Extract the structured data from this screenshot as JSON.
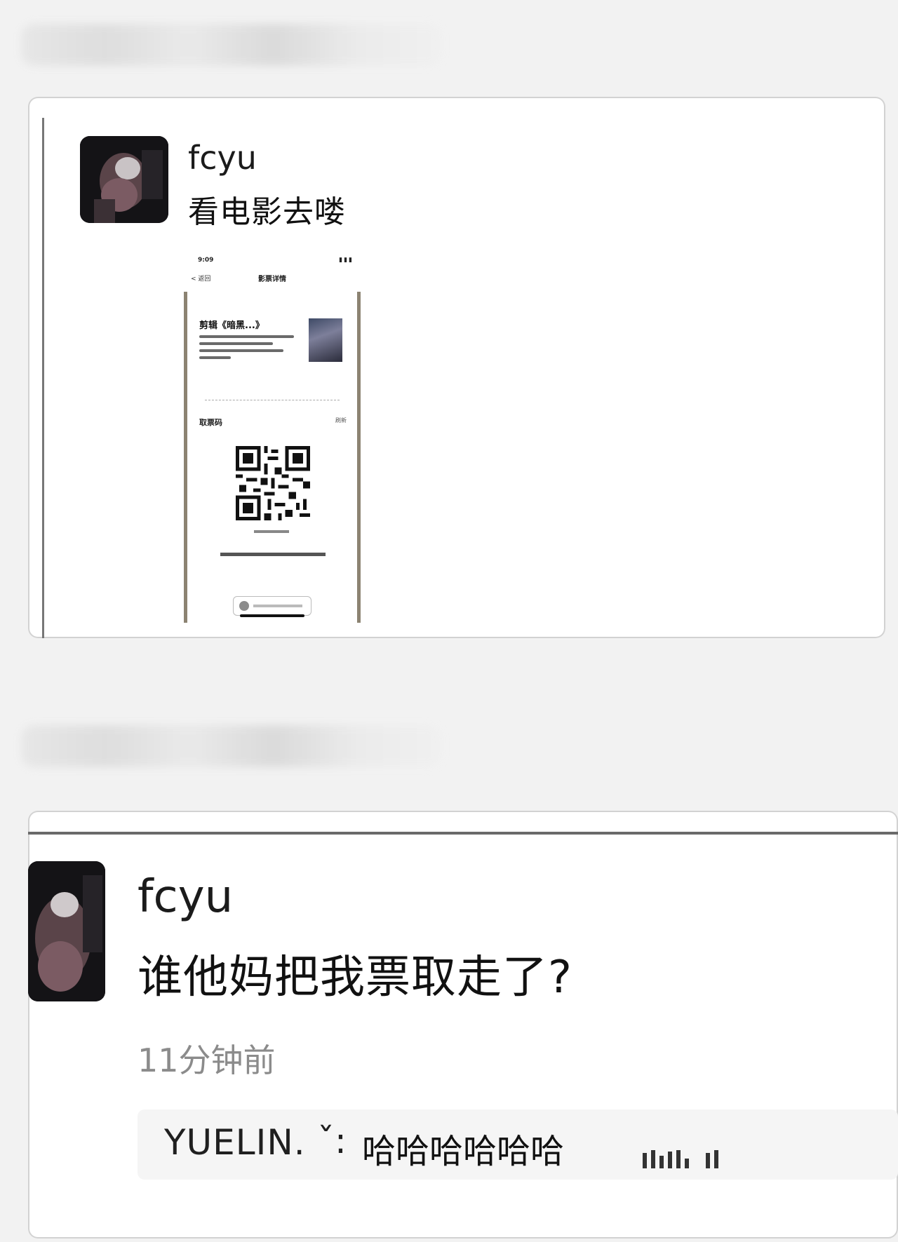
{
  "post1": {
    "username": "fcyu",
    "text": "看电影去喽",
    "ticket_screenshot": {
      "status_time": "9:09",
      "status_icons": "▮▮▮",
      "back_label": "< 返回",
      "title": "影票详情",
      "movie_title": "剪辑《暗黑...》",
      "code_label": "取票码",
      "code_right": "刷新"
    }
  },
  "post2": {
    "username": "fcyu",
    "text": "谁他妈把我票取走了?",
    "timestamp": "11分钟前",
    "comment": {
      "name": "YUELIN.",
      "separator": "ˇ:",
      "text": "哈哈哈哈哈哈"
    }
  },
  "colors": {
    "background": "#f2f2f2",
    "card": "#ffffff",
    "timestamp": "#8b8b8b",
    "comment_bg": "#f5f5f5"
  },
  "icons": {
    "avatar": "avatar-photo",
    "qr": "qr-code-icon",
    "poster": "movie-poster-icon"
  }
}
